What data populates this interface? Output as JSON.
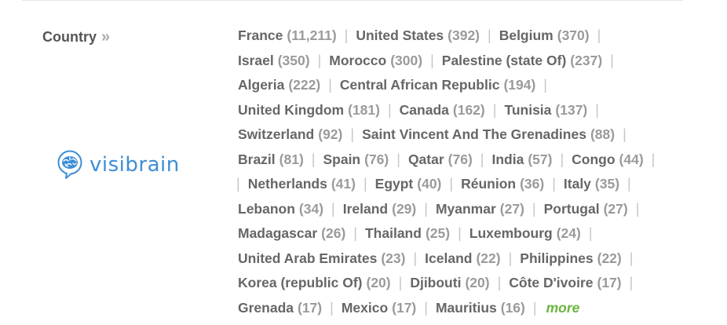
{
  "facet": {
    "label": "Country",
    "chevron": "»"
  },
  "logo": {
    "wordmark": "visibrain",
    "icon": "brain-bubble-icon",
    "color": "#3e8ed6"
  },
  "countries": [
    {
      "name": "France",
      "count": "(11,211)"
    },
    {
      "name": "United States",
      "count": "(392)"
    },
    {
      "name": "Belgium",
      "count": "(370)"
    },
    {
      "name": "Israel",
      "count": "(350)"
    },
    {
      "name": "Morocco",
      "count": "(300)"
    },
    {
      "name": "Palestine (state Of)",
      "count": "(237)"
    },
    {
      "name": "Algeria",
      "count": "(222)"
    },
    {
      "name": "Central African Republic",
      "count": "(194)"
    },
    {
      "name": "United Kingdom",
      "count": "(181)"
    },
    {
      "name": "Canada",
      "count": "(162)"
    },
    {
      "name": "Tunisia",
      "count": "(137)"
    },
    {
      "name": "Switzerland",
      "count": "(92)"
    },
    {
      "name": "Saint Vincent And The Grenadines",
      "count": "(88)"
    },
    {
      "name": "Brazil",
      "count": "(81)"
    },
    {
      "name": "Spain",
      "count": "(76)"
    },
    {
      "name": "Qatar",
      "count": "(76)"
    },
    {
      "name": "India",
      "count": "(57)"
    },
    {
      "name": "Congo",
      "count": "(44)"
    },
    {
      "name": "Netherlands",
      "count": "(41)"
    },
    {
      "name": "Egypt",
      "count": "(40)"
    },
    {
      "name": "Réunion",
      "count": "(36)"
    },
    {
      "name": "Italy",
      "count": "(35)"
    },
    {
      "name": "Lebanon",
      "count": "(34)"
    },
    {
      "name": "Ireland",
      "count": "(29)"
    },
    {
      "name": "Myanmar",
      "count": "(27)"
    },
    {
      "name": "Portugal",
      "count": "(27)"
    },
    {
      "name": "Madagascar",
      "count": "(26)"
    },
    {
      "name": "Thailand",
      "count": "(25)"
    },
    {
      "name": "Luxembourg",
      "count": "(24)"
    },
    {
      "name": "United Arab Emirates",
      "count": "(23)"
    },
    {
      "name": "Iceland",
      "count": "(22)"
    },
    {
      "name": "Philippines",
      "count": "(22)"
    },
    {
      "name": "Korea (republic Of)",
      "count": "(20)"
    },
    {
      "name": "Djibouti",
      "count": "(20)"
    },
    {
      "name": "Côte D'ivoire",
      "count": "(17)"
    },
    {
      "name": "Grenada",
      "count": "(17)"
    },
    {
      "name": "Mexico",
      "count": "(17)"
    },
    {
      "name": "Mauritius",
      "count": "(16)"
    }
  ],
  "more_label": "more",
  "separator": "|"
}
